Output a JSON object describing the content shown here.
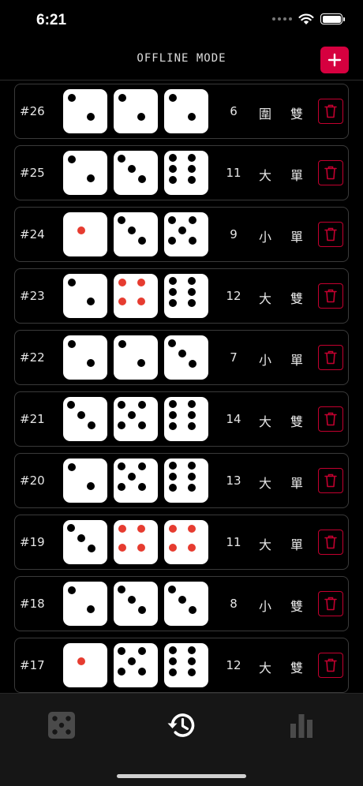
{
  "status_bar": {
    "time": "6:21"
  },
  "header": {
    "title": "OFFLINE MODE",
    "add_icon": "plus-icon"
  },
  "colors": {
    "accent": "#d6003f",
    "red_pip": "#e63c30",
    "background": "#000000"
  },
  "rows": [
    {
      "id": "#26",
      "dice": [
        2,
        2,
        2
      ],
      "sum": "6",
      "size": "圍",
      "parity": "雙"
    },
    {
      "id": "#25",
      "dice": [
        2,
        3,
        6
      ],
      "sum": "11",
      "size": "大",
      "parity": "單"
    },
    {
      "id": "#24",
      "dice": [
        1,
        3,
        5
      ],
      "sum": "9",
      "size": "小",
      "parity": "單"
    },
    {
      "id": "#23",
      "dice": [
        2,
        4,
        6
      ],
      "sum": "12",
      "size": "大",
      "parity": "雙"
    },
    {
      "id": "#22",
      "dice": [
        2,
        2,
        3
      ],
      "sum": "7",
      "size": "小",
      "parity": "單"
    },
    {
      "id": "#21",
      "dice": [
        3,
        5,
        6
      ],
      "sum": "14",
      "size": "大",
      "parity": "雙"
    },
    {
      "id": "#20",
      "dice": [
        2,
        5,
        6
      ],
      "sum": "13",
      "size": "大",
      "parity": "單"
    },
    {
      "id": "#19",
      "dice": [
        3,
        4,
        4
      ],
      "sum": "11",
      "size": "大",
      "parity": "單"
    },
    {
      "id": "#18",
      "dice": [
        2,
        3,
        3
      ],
      "sum": "8",
      "size": "小",
      "parity": "雙"
    },
    {
      "id": "#17",
      "dice": [
        1,
        5,
        6
      ],
      "sum": "12",
      "size": "大",
      "parity": "雙"
    }
  ],
  "tabbar": {
    "tabs": [
      {
        "name": "dice",
        "icon": "dice-icon",
        "active": false
      },
      {
        "name": "history",
        "icon": "history-icon",
        "active": true
      },
      {
        "name": "stats",
        "icon": "bar-chart-icon",
        "active": false
      }
    ]
  }
}
